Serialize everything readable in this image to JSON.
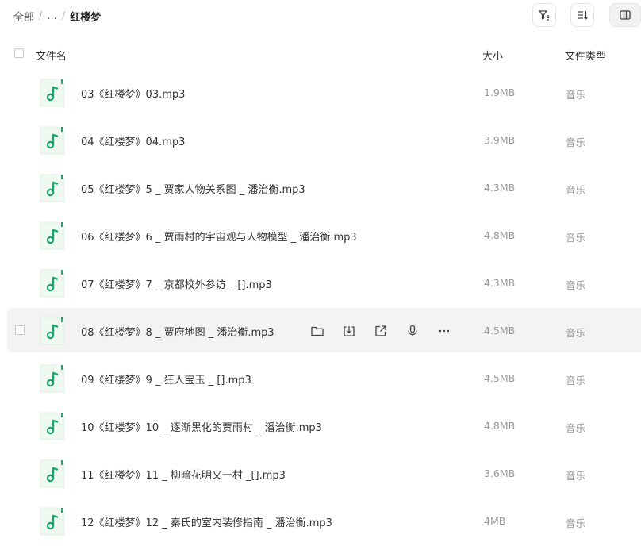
{
  "breadcrumb": {
    "root": "全部",
    "ellipsis": "...",
    "current": "红楼梦",
    "separator": "/"
  },
  "toolbar": {
    "filter_icon": "filter-icon",
    "sort_icon": "sort-icon",
    "view_icon": "column-view-icon"
  },
  "table": {
    "header": {
      "name": "文件名",
      "size": "大小",
      "type": "文件类型"
    }
  },
  "files": [
    {
      "name": "03《红楼梦》03.mp3",
      "size": "1.9MB",
      "type": "音乐"
    },
    {
      "name": "04《红楼梦》04.mp3",
      "size": "3.9MB",
      "type": "音乐"
    },
    {
      "name": "05《红楼梦》5 _ 贾家人物关系图 _ 潘治衡.mp3",
      "size": "4.3MB",
      "type": "音乐"
    },
    {
      "name": "06《红楼梦》6 _ 贾雨村的宇宙观与人物模型 _ 潘治衡.mp3",
      "size": "4.8MB",
      "type": "音乐"
    },
    {
      "name": "07《红楼梦》7 _ 京都校外参访 _ [].mp3",
      "size": "4.3MB",
      "type": "音乐"
    },
    {
      "name": "08《红楼梦》8 _ 贾府地图 _ 潘治衡.mp3",
      "size": "4.5MB",
      "type": "音乐"
    },
    {
      "name": "09《红楼梦》9 _ 狂人宝玉 _ [].mp3",
      "size": "4.5MB",
      "type": "音乐"
    },
    {
      "name": "10《红楼梦》10 _ 逐渐黑化的贾雨村 _ 潘治衡.mp3",
      "size": "4.8MB",
      "type": "音乐"
    },
    {
      "name": "11《红楼梦》11 _ 柳暗花明又一村 _[].mp3",
      "size": "3.6MB",
      "type": "音乐"
    },
    {
      "name": "12《红楼梦》12 _ 秦氏的室内装修指南 _ 潘治衡.mp3",
      "size": "4MB",
      "type": "音乐"
    }
  ],
  "hover_row_actions": [
    "folder-icon",
    "download-icon",
    "share-icon",
    "podcast-icon",
    "more-icon"
  ],
  "colors": {
    "music_green": "#1aa86a",
    "hover_bg": "#f3f3f4",
    "muted_text": "#999999"
  }
}
